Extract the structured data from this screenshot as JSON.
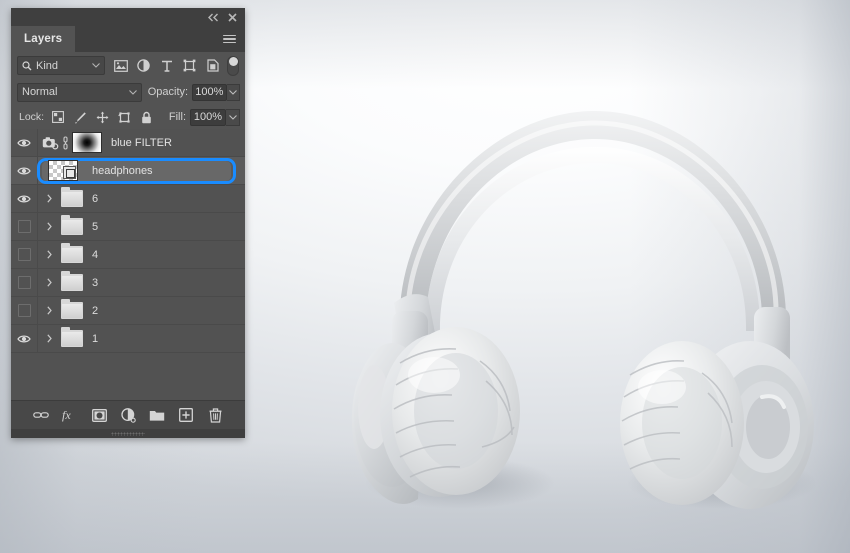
{
  "app": {
    "panel_title": "Layers"
  },
  "titlebar": {
    "collapse_icon": "double-chevron-left-icon",
    "close_icon": "close-icon"
  },
  "filter_bar": {
    "search_icon": "search-icon",
    "kind_label": "Kind",
    "kind_chevron": "chevron-down-icon",
    "type_filters": [
      {
        "name": "filter-pixel-layers-icon",
        "glyph": "image"
      },
      {
        "name": "filter-adjustment-layers-icon",
        "glyph": "adjustment"
      },
      {
        "name": "filter-type-layers-icon",
        "glyph": "type"
      },
      {
        "name": "filter-shape-layers-icon",
        "glyph": "shape"
      },
      {
        "name": "filter-smart-object-icon",
        "glyph": "smart"
      }
    ],
    "filter_toggle": "filter-enable-toggle"
  },
  "blend_bar": {
    "blend_mode": "Normal",
    "blend_chevron": "chevron-down-icon",
    "opacity_label": "Opacity:",
    "opacity_value": "100%",
    "opacity_chevron": "chevron-down-icon"
  },
  "lock_bar": {
    "lock_label": "Lock:",
    "lock_icons": [
      {
        "name": "lock-transparent-pixels-icon"
      },
      {
        "name": "lock-image-pixels-icon"
      },
      {
        "name": "lock-position-icon"
      },
      {
        "name": "lock-artboard-nesting-icon"
      },
      {
        "name": "lock-all-icon"
      }
    ],
    "fill_label": "Fill:",
    "fill_value": "100%",
    "fill_chevron": "chevron-down-icon"
  },
  "layers": [
    {
      "name": "blue FILTER",
      "visible": true,
      "type": "smart-filter",
      "thumb": "mask",
      "has_camera_icon": true,
      "has_link_icon": true,
      "selected": false,
      "expandable": false
    },
    {
      "name": "headphones",
      "visible": true,
      "type": "smart-object",
      "thumb": "checker",
      "has_camera_icon": false,
      "has_link_icon": false,
      "selected": true,
      "expandable": false
    },
    {
      "name": "6",
      "visible": true,
      "type": "group",
      "selected": false,
      "expandable": true
    },
    {
      "name": "5",
      "visible": false,
      "type": "group",
      "selected": false,
      "expandable": true
    },
    {
      "name": "4",
      "visible": false,
      "type": "group",
      "selected": false,
      "expandable": true
    },
    {
      "name": "3",
      "visible": false,
      "type": "group",
      "selected": false,
      "expandable": true
    },
    {
      "name": "2",
      "visible": false,
      "type": "group",
      "selected": false,
      "expandable": true
    },
    {
      "name": "1",
      "visible": true,
      "type": "group",
      "selected": false,
      "expandable": true
    }
  ],
  "footer": {
    "buttons": [
      {
        "name": "link-layers-button",
        "glyph": "link"
      },
      {
        "name": "layer-style-fx-button",
        "glyph": "fx"
      },
      {
        "name": "add-layer-mask-button",
        "glyph": "mask"
      },
      {
        "name": "new-adjustment-layer-button",
        "glyph": "adjustment"
      },
      {
        "name": "new-group-button",
        "glyph": "folder"
      },
      {
        "name": "new-layer-button",
        "glyph": "new"
      },
      {
        "name": "delete-layer-button",
        "glyph": "trash"
      }
    ]
  },
  "colors": {
    "panel_bg": "#535353",
    "panel_header": "#3f3f3f",
    "selection_blue": "#1a8cff",
    "row_selected": "#686868",
    "text": "#e2e2e2"
  },
  "canvas": {
    "subject": "headphones-product-render",
    "background": "light-gray-gradient"
  }
}
